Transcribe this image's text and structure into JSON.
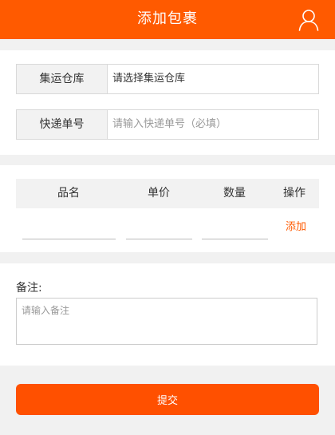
{
  "header": {
    "title": "添加包裹",
    "user_icon": "user-icon"
  },
  "form": {
    "warehouse": {
      "label": "集运仓库",
      "value": "请选择集运仓库"
    },
    "tracking": {
      "label": "快递单号",
      "placeholder": "请输入快递单号（必填）"
    }
  },
  "items_table": {
    "columns": [
      "品名",
      "单价",
      "数量",
      "操作"
    ],
    "add_label": "添加"
  },
  "remark": {
    "label": "备注:",
    "placeholder": "请输入备注"
  },
  "submit_label": "提交",
  "colors": {
    "accent": "#ff5a00",
    "button": "#ff5000",
    "page_bg": "#f1f1f1"
  }
}
